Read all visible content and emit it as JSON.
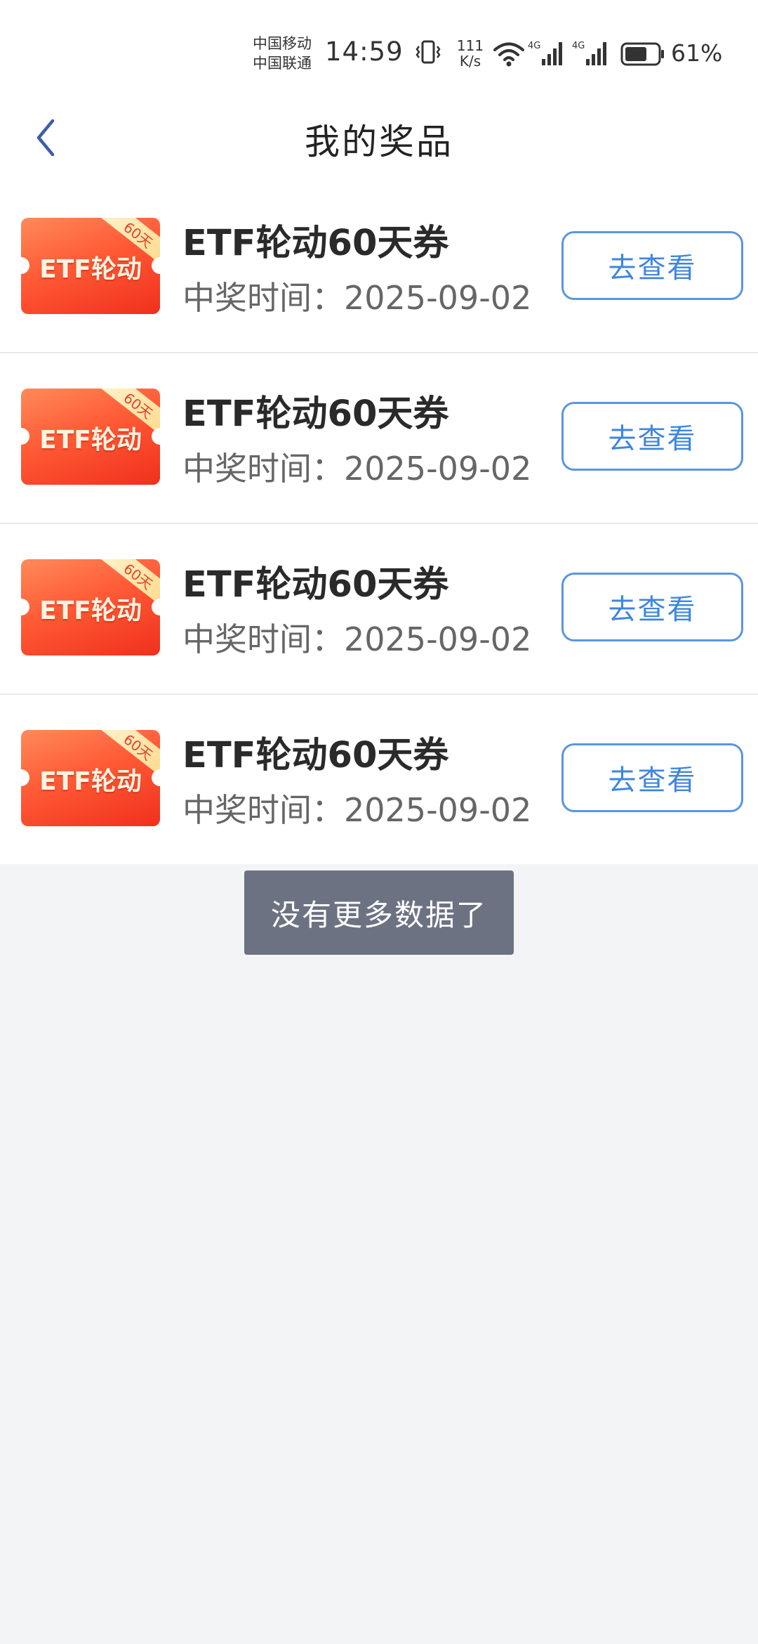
{
  "status_bar": {
    "carrier_1": "中国移动",
    "carrier_2": "中国联通",
    "time": "14:59",
    "net_speed_value": "111",
    "net_speed_unit": "K/s",
    "battery": "61%",
    "icons": [
      "vibrate-icon",
      "wifi-icon",
      "signal-4g-icon",
      "signal-4g-icon",
      "battery-icon"
    ]
  },
  "header": {
    "title": "我的奖品",
    "back_icon": "chevron-left-icon"
  },
  "colors": {
    "accent_blue": "#3d86de",
    "coupon_red": "#f0301c",
    "toast_bg": "#6d7283"
  },
  "prizes": [
    {
      "coupon_label": "ETF轮动",
      "coupon_badge": "60天",
      "name": "ETF轮动60天券",
      "date": "中奖时间：2025-09-02",
      "action": "去查看"
    },
    {
      "coupon_label": "ETF轮动",
      "coupon_badge": "60天",
      "name": "ETF轮动60天券",
      "date": "中奖时间：2025-09-02",
      "action": "去查看"
    },
    {
      "coupon_label": "ETF轮动",
      "coupon_badge": "60天",
      "name": "ETF轮动60天券",
      "date": "中奖时间：2025-09-02",
      "action": "去查看"
    },
    {
      "coupon_label": "ETF轮动",
      "coupon_badge": "60天",
      "name": "ETF轮动60天券",
      "date": "中奖时间：2025-09-02",
      "action": "去查看"
    }
  ],
  "toast": {
    "text": "没有更多数据了"
  }
}
